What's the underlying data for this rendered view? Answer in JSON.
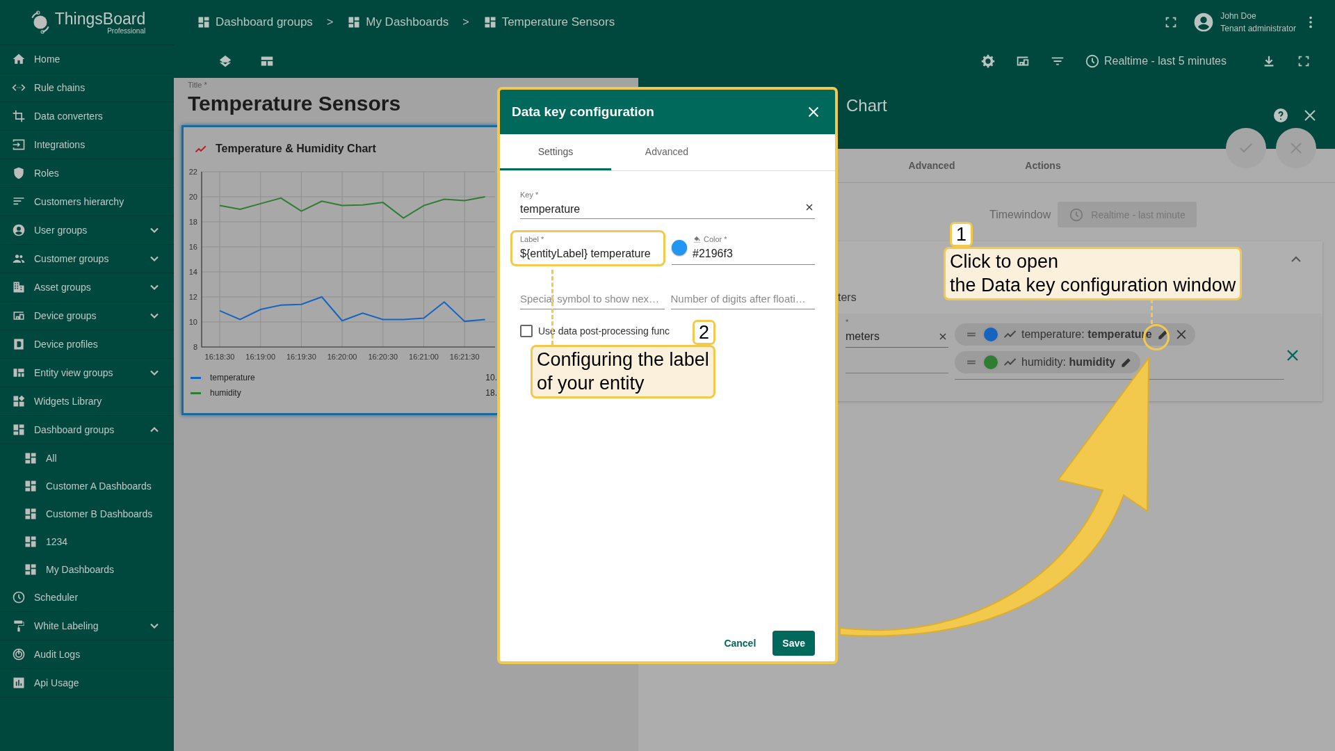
{
  "sidebar": {
    "logo": {
      "name": "ThingsBoard",
      "edition": "Professional"
    },
    "items": [
      {
        "label": "Home"
      },
      {
        "label": "Rule chains"
      },
      {
        "label": "Data converters"
      },
      {
        "label": "Integrations"
      },
      {
        "label": "Roles"
      },
      {
        "label": "Customers hierarchy"
      },
      {
        "label": "User groups",
        "expanded": false
      },
      {
        "label": "Customer groups",
        "expanded": false
      },
      {
        "label": "Asset groups",
        "expanded": false
      },
      {
        "label": "Device groups",
        "expanded": false
      },
      {
        "label": "Device profiles"
      },
      {
        "label": "Entity view groups",
        "expanded": false
      },
      {
        "label": "Widgets Library"
      },
      {
        "label": "Dashboard groups",
        "expanded": true,
        "children": [
          {
            "label": "All"
          },
          {
            "label": "Customer A Dashboards"
          },
          {
            "label": "Customer B Dashboards"
          },
          {
            "label": "1234"
          },
          {
            "label": "My Dashboards"
          }
        ]
      },
      {
        "label": "Scheduler"
      },
      {
        "label": "White Labeling",
        "expanded": false
      },
      {
        "label": "Audit Logs"
      },
      {
        "label": "Api Usage"
      }
    ]
  },
  "header": {
    "breadcrumbs": [
      "Dashboard groups",
      "My Dashboards",
      "Temperature Sensors"
    ],
    "separators": [
      ">",
      ">"
    ],
    "user": {
      "name": "John Doe",
      "role": "Tenant administrator"
    },
    "timewindow": "Realtime - last 5 minutes"
  },
  "dashboard": {
    "title_label": "Title *",
    "title": "Temperature Sensors",
    "widget": {
      "title": "Temperature & Humidity Chart",
      "chart_data": {
        "type": "line",
        "grid": true,
        "categories": [
          "16:18:30",
          null,
          "16:19:00",
          null,
          "16:19:30",
          null,
          "16:20:00",
          null,
          "16:20:30",
          null,
          "16:21:00",
          null,
          "16:21:30",
          null
        ],
        "series": [
          {
            "name": "temperature",
            "color": "#1565c0",
            "values": [
              10.9,
              10.2,
              11.0,
              11.35,
              11.4,
              12.0,
              10.1,
              10.7,
              10.2,
              10.2,
              10.3,
              11.6,
              10.05,
              10.2
            ]
          },
          {
            "name": "humidity",
            "color": "#2e7d32",
            "values": [
              19.3,
              19.0,
              19.45,
              19.9,
              18.85,
              19.65,
              19.3,
              19.35,
              19.55,
              18.3,
              19.3,
              19.8,
              19.7,
              20.0
            ]
          }
        ],
        "ylim": [
          8,
          22
        ],
        "yticks": [
          8,
          10,
          12,
          14,
          16,
          18,
          20,
          22
        ]
      },
      "legend_values": [
        "10.",
        "18."
      ]
    }
  },
  "widget_editor": {
    "title": "Chart",
    "tabs": [
      {
        "label": "Advanced"
      },
      {
        "label": "Actions"
      }
    ],
    "timewindow_label": "Timewindow",
    "timewindow_value": "Realtime - last minute",
    "section_title": "ters",
    "field_label": "*",
    "field_value": "meters",
    "data_keys": [
      {
        "text": "temperature: **temperature**",
        "color": "#1565c0"
      },
      {
        "text": "humidity: **humidity**",
        "color": "#2e7d32"
      }
    ]
  },
  "dialog": {
    "title": "Data key configuration",
    "tabs": [
      {
        "label": "Settings",
        "selected": true
      },
      {
        "label": "Advanced",
        "selected": false
      }
    ],
    "key": {
      "label": "Key *",
      "value": "temperature"
    },
    "label_field": {
      "label": "Label *",
      "value": "${entityLabel} temperature"
    },
    "color_field": {
      "label": "Color *",
      "value": "#2196f3",
      "color": "#2196f3"
    },
    "units": {
      "placeholder": "Special symbol to show nex…"
    },
    "decimals": {
      "placeholder": "Number of digits after floati…"
    },
    "postprocessing": {
      "label": "Use data post-processing func",
      "checked": false
    },
    "cancel": "Cancel",
    "save": "Save"
  },
  "annotations": [
    {
      "number": "1",
      "text": "Click to open\nthe Data key configuration window"
    },
    {
      "number": "2",
      "text": "Configuring the label\nof your entity"
    }
  ]
}
